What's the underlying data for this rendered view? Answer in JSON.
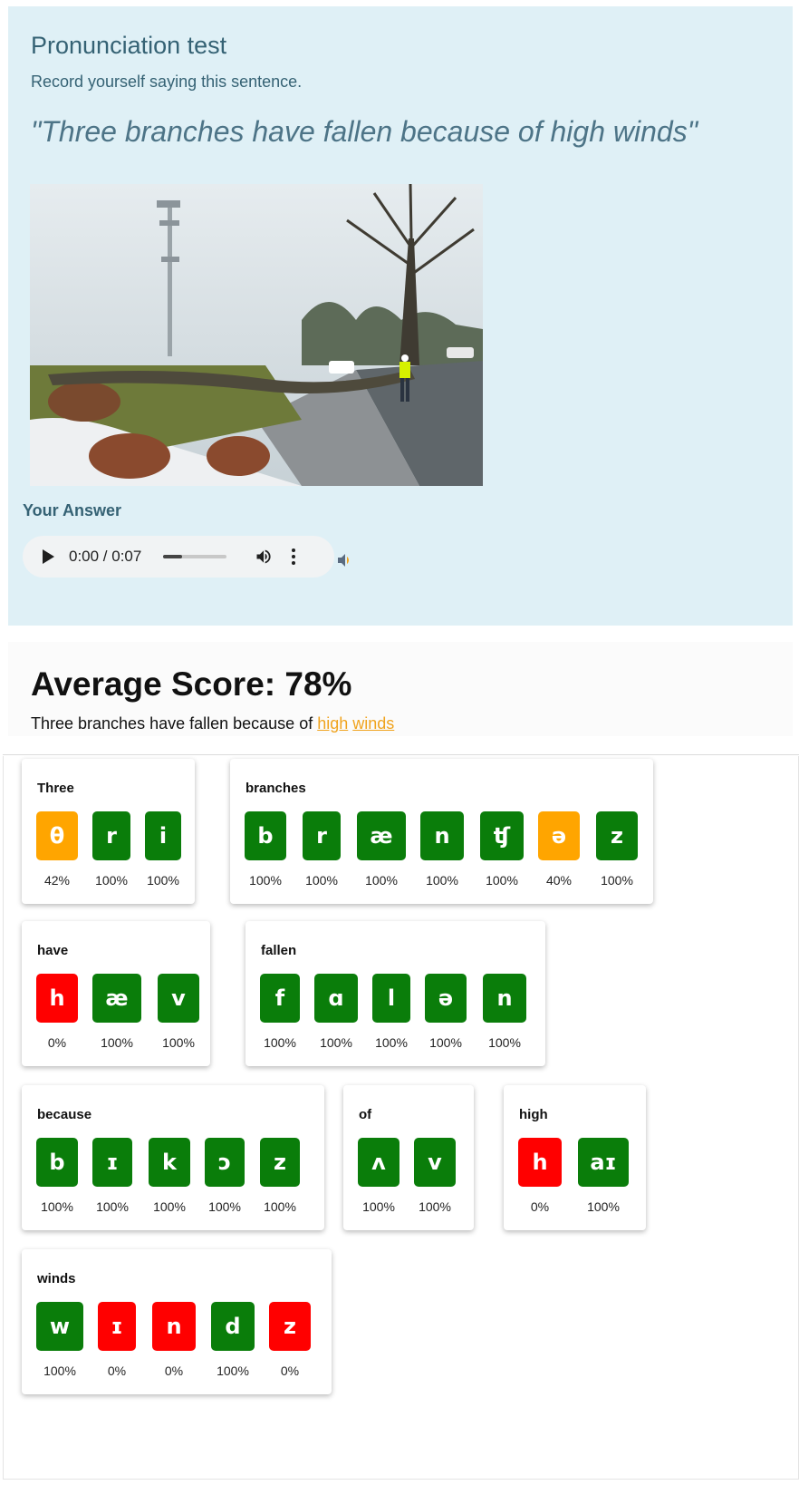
{
  "test": {
    "title": "Pronunciation test",
    "instruction": "Record yourself saying this sentence.",
    "sentence": "\"Three branches have fallen because of high winds\"",
    "answer_label": "Your Answer",
    "audio_time": "0:00 / 0:07",
    "audio_progress": 0.3
  },
  "score": {
    "title": "Average Score: 78%",
    "sentence_plain": "Three branches have fallen because of",
    "link_high": "high",
    "link_winds": "winds"
  },
  "colors": {
    "good": "#0a7d0a",
    "medium": "#ffa500",
    "bad": "#ff0000",
    "link": "#f0a31d"
  },
  "words": [
    {
      "word": "Three",
      "phonemes": [
        {
          "p": "θ",
          "score": "42%",
          "level": "o"
        },
        {
          "p": "r",
          "score": "100%",
          "level": "g"
        },
        {
          "p": "i",
          "score": "100%",
          "level": "g"
        }
      ]
    },
    {
      "word": "branches",
      "phonemes": [
        {
          "p": "b",
          "score": "100%",
          "level": "g"
        },
        {
          "p": "r",
          "score": "100%",
          "level": "g"
        },
        {
          "p": "æ",
          "score": "100%",
          "level": "g"
        },
        {
          "p": "n",
          "score": "100%",
          "level": "g"
        },
        {
          "p": "ʧ",
          "score": "100%",
          "level": "g"
        },
        {
          "p": "ə",
          "score": "40%",
          "level": "o"
        },
        {
          "p": "z",
          "score": "100%",
          "level": "g"
        }
      ]
    },
    {
      "word": "have",
      "phonemes": [
        {
          "p": "h",
          "score": "0%",
          "level": "r"
        },
        {
          "p": "æ",
          "score": "100%",
          "level": "g"
        },
        {
          "p": "v",
          "score": "100%",
          "level": "g"
        }
      ]
    },
    {
      "word": "fallen",
      "phonemes": [
        {
          "p": "f",
          "score": "100%",
          "level": "g"
        },
        {
          "p": "ɑ",
          "score": "100%",
          "level": "g"
        },
        {
          "p": "l",
          "score": "100%",
          "level": "g"
        },
        {
          "p": "ə",
          "score": "100%",
          "level": "g"
        },
        {
          "p": "n",
          "score": "100%",
          "level": "g"
        }
      ]
    },
    {
      "word": "because",
      "phonemes": [
        {
          "p": "b",
          "score": "100%",
          "level": "g"
        },
        {
          "p": "ɪ",
          "score": "100%",
          "level": "g"
        },
        {
          "p": "k",
          "score": "100%",
          "level": "g"
        },
        {
          "p": "ɔ",
          "score": "100%",
          "level": "g"
        },
        {
          "p": "z",
          "score": "100%",
          "level": "g"
        }
      ]
    },
    {
      "word": "of",
      "phonemes": [
        {
          "p": "ʌ",
          "score": "100%",
          "level": "g"
        },
        {
          "p": "v",
          "score": "100%",
          "level": "g"
        }
      ]
    },
    {
      "word": "high",
      "phonemes": [
        {
          "p": "h",
          "score": "0%",
          "level": "r"
        },
        {
          "p": "aɪ",
          "score": "100%",
          "level": "g"
        }
      ]
    },
    {
      "word": "winds",
      "phonemes": [
        {
          "p": "w",
          "score": "100%",
          "level": "g"
        },
        {
          "p": "ɪ",
          "score": "0%",
          "level": "r"
        },
        {
          "p": "n",
          "score": "0%",
          "level": "r"
        },
        {
          "p": "d",
          "score": "100%",
          "level": "g"
        },
        {
          "p": "z",
          "score": "0%",
          "level": "r"
        }
      ]
    }
  ]
}
